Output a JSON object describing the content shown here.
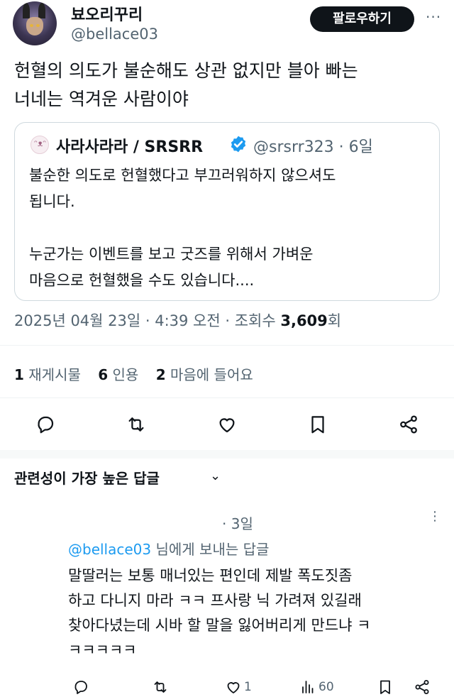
{
  "author": {
    "display_name": "뵤오리꾸리",
    "handle": "@bellace03"
  },
  "follow_label": "팔로우하기",
  "more_label": "···",
  "tweet": {
    "line1": "헌혈의 의도가 불순해도 상관 없지만 블아 빠는",
    "line2": "너네는 역겨운 사람이야"
  },
  "quote": {
    "name": "사라사라라 / SRSRR",
    "handle_time": "@srsrr323 · 6일",
    "text": "불순한 의도로 헌혈했다고 부끄러워하지 않으셔도\n됩니다.\n\n누군가는 이벤트를 보고 굿즈를 위해서 가벼운\n마음으로 헌혈했을 수도 있습니다...."
  },
  "timestamp": {
    "prefix": "2025년 04월 23일 · 4:39 오전 · 조회수 ",
    "views": "3,609",
    "suffix": "회"
  },
  "stats": [
    {
      "count": "1",
      "label": "재게시물"
    },
    {
      "count": "6",
      "label": "인용"
    },
    {
      "count": "2",
      "label": "마음에 들어요"
    }
  ],
  "sort": {
    "label": "관련성이 가장 높은 답글",
    "chevron": "⌄"
  },
  "reply": {
    "time": "· 3일",
    "more": "⋮",
    "to_handle": "@bellace03",
    "to_suffix": " 님에게 보내는 답글",
    "text": "말딸러는 보통 매너있는 편인데 제발 폭도짓좀\n하고 다니지 마라 ㅋㅋ 프사랑 닉 가려져 있길래\n찾아다녔는데 시바 할 말을 잃어버리게 만드냐 ㅋ\nㅋㅋㅋㅋㅋ",
    "likes": "1",
    "views": "60"
  },
  "icons": [
    "reply-icon",
    "retweet-icon",
    "like-icon",
    "bookmark-icon",
    "share-icon",
    "verified-icon",
    "views-icon"
  ],
  "colors": {
    "accent": "#1d9bf0",
    "text": "#0f1419",
    "muted": "#536471",
    "button": "#0f1419"
  }
}
